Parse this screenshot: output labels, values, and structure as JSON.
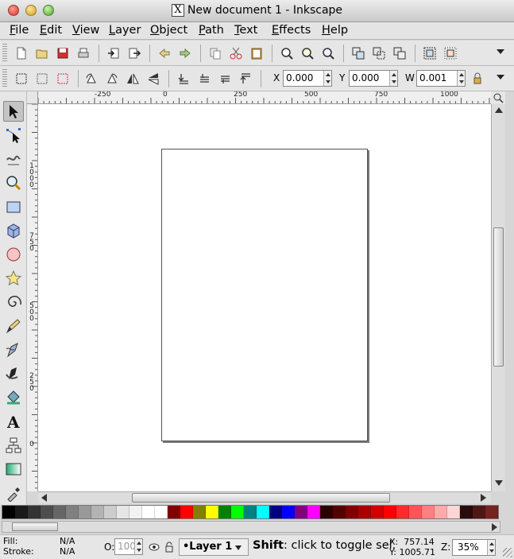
{
  "window": {
    "title": "New document 1 - Inkscape",
    "x11_glyph": "X"
  },
  "menu": [
    "File",
    "Edit",
    "View",
    "Layer",
    "Object",
    "Path",
    "Text",
    "Effects",
    "Help"
  ],
  "toolbar_commands": {
    "icons": [
      "new-icon",
      "open-icon",
      "save-icon",
      "print-icon",
      "import-icon",
      "export-icon",
      "undo-icon",
      "redo-icon",
      "copy-icon",
      "cut-icon",
      "paste-icon",
      "zoom-selection-icon",
      "zoom-drawing-icon",
      "zoom-page-icon",
      "duplicate-icon",
      "clone-icon",
      "unlink-clone-icon",
      "group-icon",
      "ungroup-icon"
    ]
  },
  "toolbar_select": {
    "x_label": "X",
    "x_value": "0.000",
    "y_label": "Y",
    "y_value": "0.000",
    "w_label": "W",
    "w_value": "0.001"
  },
  "ruler": {
    "top_labels": [
      "-250",
      "0",
      "250",
      "500",
      "750",
      "1000"
    ],
    "left_labels": [
      "1000",
      "750",
      "500",
      "250",
      "0"
    ]
  },
  "palette_colors": [
    "#000000",
    "#1a1a1a",
    "#333333",
    "#4d4d4d",
    "#666666",
    "#808080",
    "#999999",
    "#b3b3b3",
    "#cccccc",
    "#e6e6e6",
    "#f2f2f2",
    "#ffffff",
    "#ffffff",
    "#800000",
    "#ff0000",
    "#808000",
    "#ffff00",
    "#008000",
    "#00ff00",
    "#008080",
    "#00ffff",
    "#000080",
    "#0000ff",
    "#800080",
    "#ff00ff",
    "#2b0000",
    "#550000",
    "#800000",
    "#aa0000",
    "#d40000",
    "#ff0000",
    "#ff2a2a",
    "#ff5555",
    "#ff8080",
    "#ffaaaa",
    "#ffd5d5",
    "#280b0b",
    "#501616",
    "#782121"
  ],
  "status": {
    "fill_label": "Fill:",
    "fill_value": "N/A",
    "stroke_label": "Stroke:",
    "stroke_value": "N/A",
    "opacity_label": "O:",
    "opacity_value": "100",
    "layer": "•Layer 1",
    "message_bold": "Shift",
    "message_rest": ": click to toggle sel.",
    "x_label": "X:",
    "x_value": "757.14",
    "y_label": "Y:",
    "y_value": "1005.71",
    "zoom_label": "Z:",
    "zoom_value": "35%"
  }
}
